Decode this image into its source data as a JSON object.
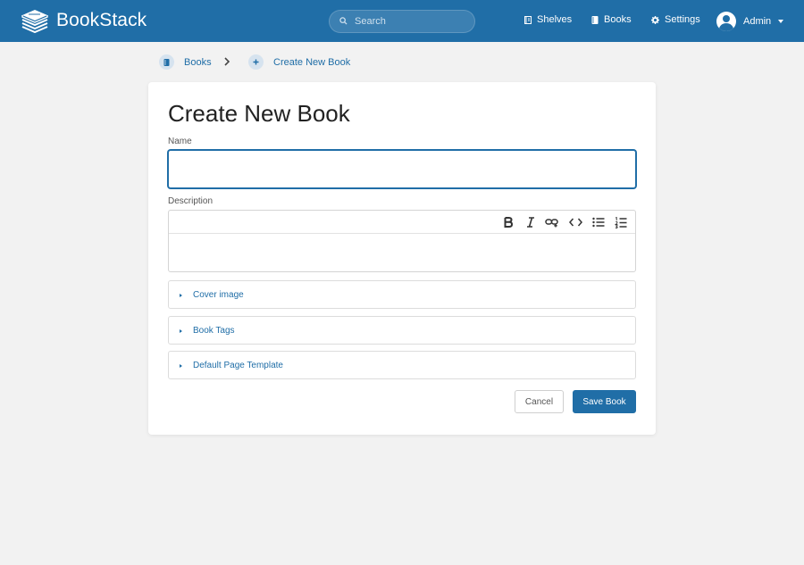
{
  "header": {
    "brand": "BookStack",
    "search_placeholder": "Search",
    "nav": [
      {
        "label": "Shelves",
        "icon": "shelves-icon"
      },
      {
        "label": "Books",
        "icon": "book-icon"
      },
      {
        "label": "Settings",
        "icon": "gear-icon"
      }
    ],
    "user": {
      "name": "Admin",
      "icon": "user-avatar-icon"
    }
  },
  "breadcrumb": [
    {
      "label": "Books",
      "icon": "book-icon"
    },
    {
      "label": "Create New Book",
      "icon": "plus-icon"
    }
  ],
  "form": {
    "title": "Create New Book",
    "name_label": "Name",
    "name_value": "",
    "description_label": "Description",
    "description_value": "",
    "toolbar": [
      "bold-icon",
      "italic-icon",
      "link-icon",
      "code-icon",
      "bullet-list-icon",
      "numbered-list-icon"
    ],
    "sections": [
      "Cover image",
      "Book Tags",
      "Default Page Template"
    ],
    "cancel_label": "Cancel",
    "save_label": "Save Book"
  },
  "colors": {
    "brand": "#206ea7",
    "background": "#f2f2f2"
  }
}
